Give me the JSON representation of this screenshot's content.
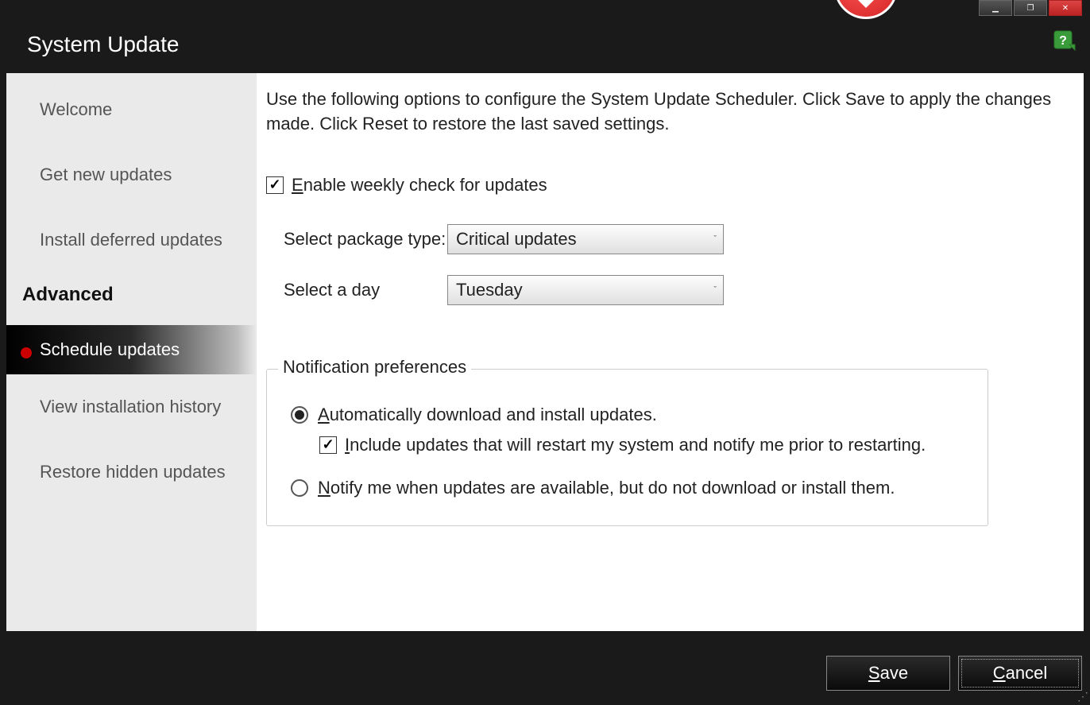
{
  "header": {
    "title": "System Update"
  },
  "sidebar": {
    "items": [
      {
        "label": "Welcome"
      },
      {
        "label": "Get new updates"
      },
      {
        "label": "Install deferred updates"
      }
    ],
    "section": "Advanced",
    "advanced_items": [
      {
        "label": "Schedule updates",
        "active": true
      },
      {
        "label": "View installation history"
      },
      {
        "label": "Restore hidden updates"
      }
    ]
  },
  "content": {
    "intro": "Use the following options to configure the System Update Scheduler. Click Save to apply the changes made. Click Reset to restore the last saved settings.",
    "enable_label": "Enable weekly check for updates",
    "enable_checked": true,
    "package_label": "Select package type:",
    "package_value": "Critical updates",
    "day_label": "Select a day",
    "day_value": "Tuesday",
    "fieldset_legend": "Notification preferences",
    "radio1": "Automatically download and install updates.",
    "radio1_selected": true,
    "sub_check": "Include updates that will restart my system and notify me prior to restarting.",
    "sub_checked": true,
    "radio2": "Notify me when updates are available, but do not download or install them.",
    "radio2_selected": false
  },
  "buttons": {
    "save": "Save",
    "cancel": "Cancel"
  }
}
